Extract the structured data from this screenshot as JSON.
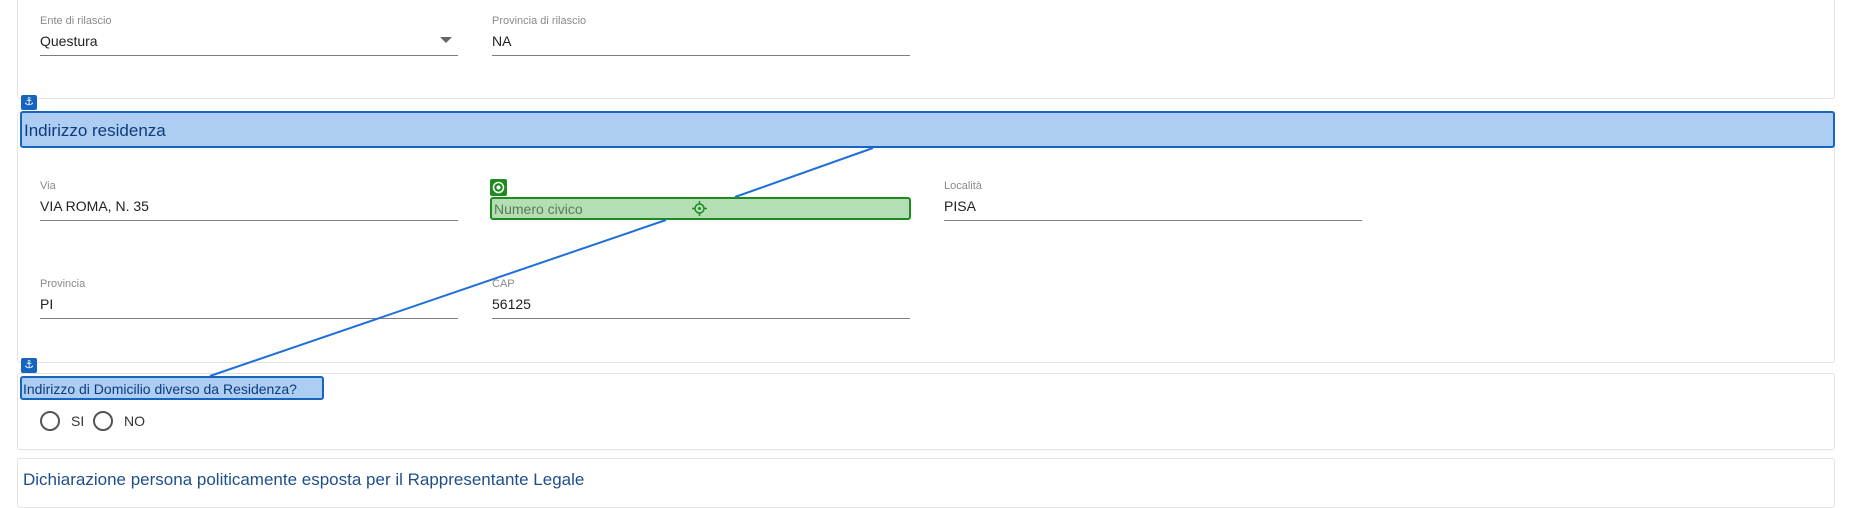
{
  "issuance": {
    "ente": {
      "label": "Ente di rilascio",
      "value": "Questura"
    },
    "provincia": {
      "label": "Provincia di rilascio",
      "value": "NA"
    }
  },
  "residence": {
    "title": "Indirizzo residenza",
    "via": {
      "label": "Via",
      "value": "VIA ROMA, N. 35"
    },
    "numero_civico": {
      "placeholder": "Numero civico"
    },
    "localita": {
      "label": "Località",
      "value": "PISA"
    },
    "provincia": {
      "label": "Provincia",
      "value": "PI"
    },
    "cap": {
      "label": "CAP",
      "value": "56125"
    }
  },
  "domicile": {
    "question": "Indirizzo di Domicilio diverso da Residenza?",
    "options": [
      "SI",
      "NO"
    ]
  },
  "pep": {
    "title": "Dichiarazione persona politicamente esposta per il Rappresentante Legale"
  },
  "overlay": {
    "anchor_icon": "anchor-icon",
    "target_icon": "target-icon",
    "crosshair_icon": "crosshair-icon",
    "colors": {
      "anchor": "#1565c0",
      "anchor_fill": "#aecdf3",
      "target": "#1f8a1f",
      "target_fill": "#b4dfb4"
    }
  }
}
